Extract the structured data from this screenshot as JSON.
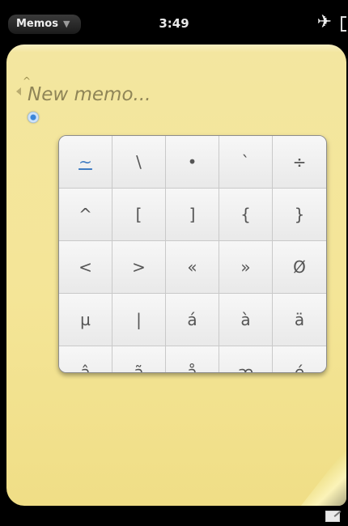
{
  "status_bar": {
    "app_menu_label": "Memos",
    "app_menu_chevron": "▼",
    "time": "3:49",
    "airplane_icon": "✈"
  },
  "memo": {
    "placeholder": "New memo...",
    "background_color": "#f3e6a0"
  },
  "symbol_picker": {
    "rows": [
      [
        "~",
        "\\",
        "•",
        "`",
        "÷"
      ],
      [
        "^",
        "[",
        "]",
        "{",
        "}"
      ],
      [
        "<",
        ">",
        "«",
        "»",
        "Ø"
      ],
      [
        "µ",
        "|",
        "á",
        "à",
        "ä"
      ],
      [
        "â",
        "ã",
        "å",
        "æ",
        "é"
      ]
    ],
    "selected_symbol": "~"
  },
  "icons": {
    "app_menu": "chevron-down-icon",
    "airplane": "airplane-icon",
    "battery": "battery-icon",
    "page_curl": "page-curl-icon",
    "new_memo": "new-memo-icon"
  }
}
